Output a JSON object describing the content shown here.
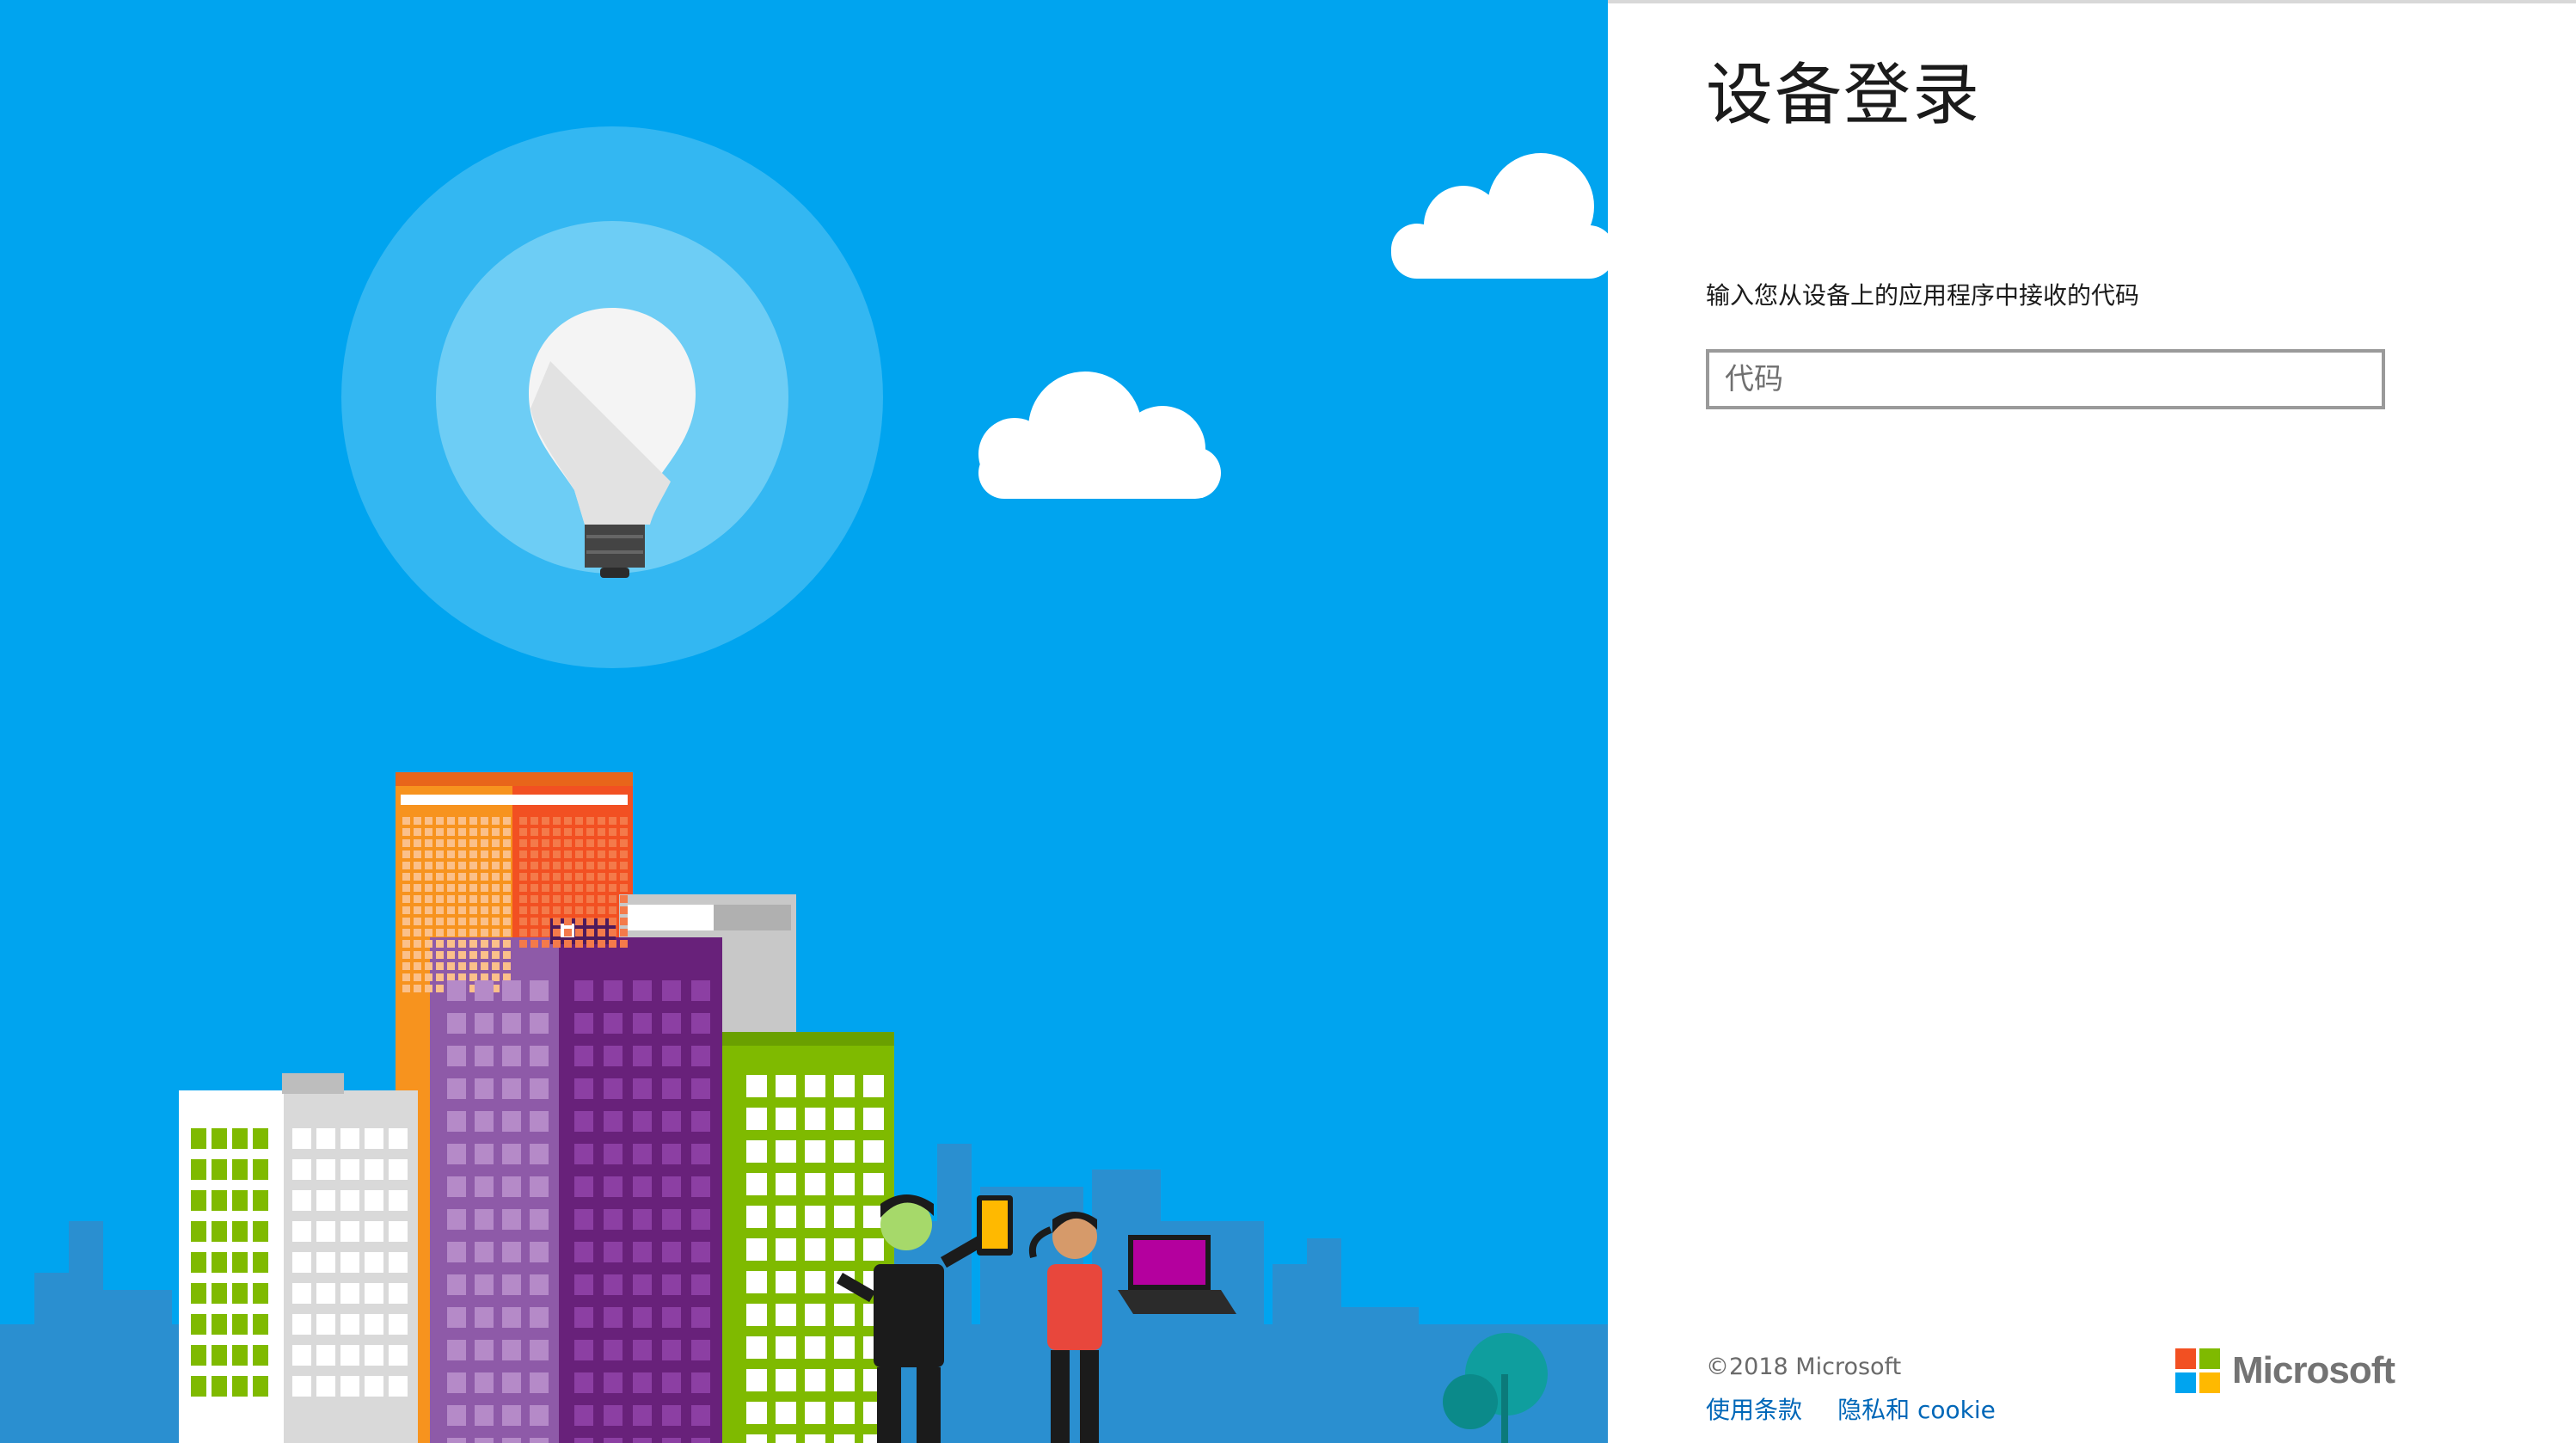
{
  "page": {
    "title": "设备登录",
    "prompt": "输入您从设备上的应用程序中接收的代码",
    "code_input": {
      "placeholder": "代码",
      "value": ""
    }
  },
  "footer": {
    "copyright": "©2018 Microsoft",
    "links": [
      {
        "label": "使用条款"
      },
      {
        "label": "隐私和 cookie"
      }
    ]
  },
  "brand": {
    "name": "Microsoft",
    "logo_colors": [
      "#f25022",
      "#7fba00",
      "#00a4ef",
      "#ffb900"
    ]
  },
  "colors": {
    "illustration_background": "#00a4ef",
    "link": "#0067b8",
    "input_border": "#9a9a9a"
  },
  "illustration": {
    "elements": [
      "lightbulb-icon",
      "cloud",
      "city-skyline",
      "people-with-devices"
    ]
  }
}
